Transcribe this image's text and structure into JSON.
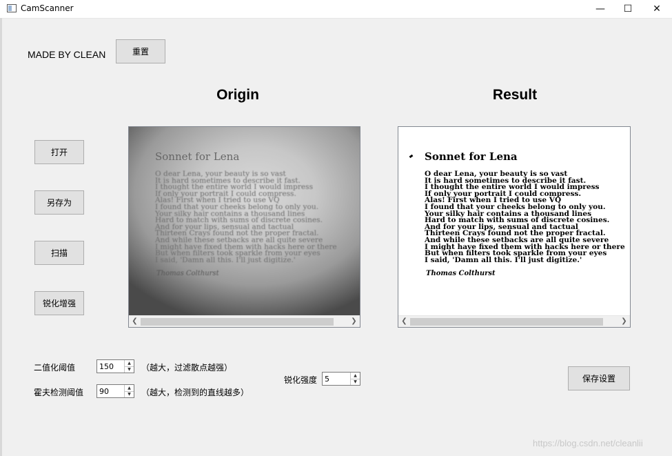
{
  "window": {
    "title": "CamScanner",
    "min_glyph": "—",
    "max_glyph": "☐",
    "close_glyph": "✕"
  },
  "header": {
    "made_by": "MADE BY CLEAN",
    "reset_label": "重置"
  },
  "side_buttons": [
    {
      "label": "打开"
    },
    {
      "label": "另存为"
    },
    {
      "label": "扫描"
    },
    {
      "label": "锐化增强"
    }
  ],
  "panels": {
    "origin_title": "Origin",
    "result_title": "Result"
  },
  "document": {
    "heading": "Sonnet for Lena",
    "lines": [
      "O dear Lena, your beauty is so vast",
      "It is hard sometimes to describe it fast.",
      "I thought the entire world I would impress",
      "If only your portrait I could compress.",
      "Alas! First when I tried to use VQ",
      "I found that your cheeks belong to only you.",
      "Your silky hair contains a thousand lines",
      "Hard to match with sums of discrete cosines.",
      "And for your lips, sensual and tactual",
      "Thirteen Crays found not the proper fractal.",
      "And while these setbacks are all quite severe",
      "I might have fixed them with hacks here or there",
      "But when filters took sparkle from your eyes",
      "I said, 'Damn all this. I'll just digitize.'"
    ],
    "signature": "Thomas Colthurst"
  },
  "settings": {
    "binary_threshold": {
      "label": "二值化阈值",
      "value": "150",
      "hint": "（越大，过滤散点越强）"
    },
    "hough_threshold": {
      "label": "霍夫检测阈值",
      "value": "90",
      "hint": "（越大，检测到的直线越多）"
    },
    "sharpen_strength": {
      "label": "锐化强度",
      "value": "5"
    },
    "save_label": "保存设置"
  },
  "watermark": "https://blog.csdn.net/cleanlii"
}
